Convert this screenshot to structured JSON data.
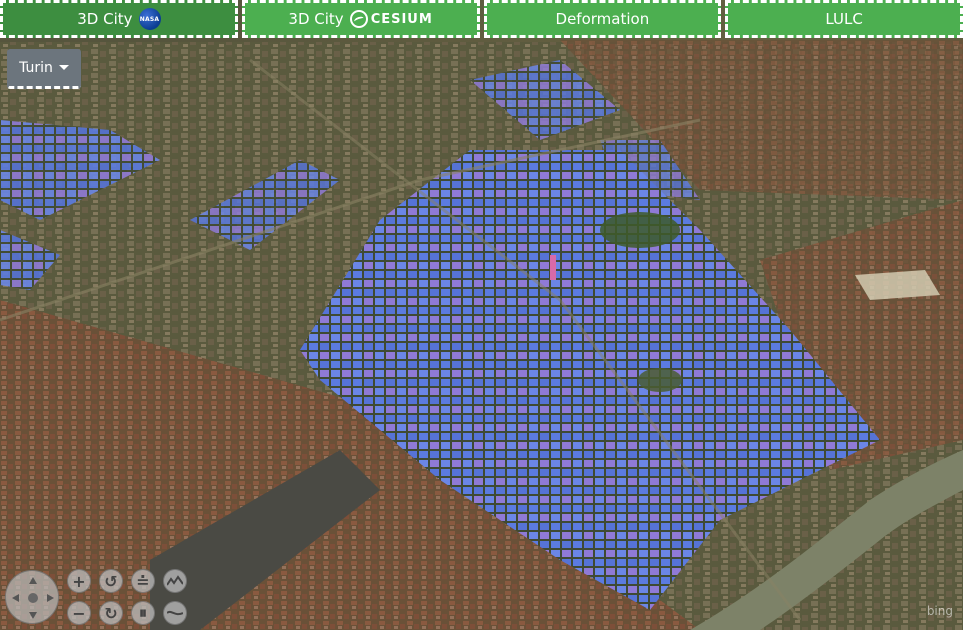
{
  "tabs": [
    {
      "label": "3D City",
      "logo": "nasa-logo",
      "logo_text": "NASA",
      "active": true
    },
    {
      "label": "3D City",
      "logo": "cesium-logo",
      "logo_text": "CESIUM",
      "active": false
    },
    {
      "label": "Deformation",
      "active": false
    },
    {
      "label": "LULC",
      "active": false
    }
  ],
  "city_select": {
    "value": "Turin",
    "icon": "caret-down-icon"
  },
  "navigation": {
    "joystick": "pan-joystick-icon",
    "buttons_top": [
      "zoom-in-icon",
      "rotate-left-icon",
      "tilt-up-icon",
      "terrain-icon"
    ],
    "buttons_bottom": [
      "zoom-out-icon",
      "rotate-right-icon",
      "tilt-down-icon",
      "level-icon"
    ]
  },
  "attribution": "bing",
  "colors": {
    "tab_green": "#4caf50",
    "tab_active": "#3d8e40",
    "buildings_blue": "#5b7be0",
    "buildings_purple": "#8f7ad6",
    "dropdown_gray": "#6c757d"
  }
}
